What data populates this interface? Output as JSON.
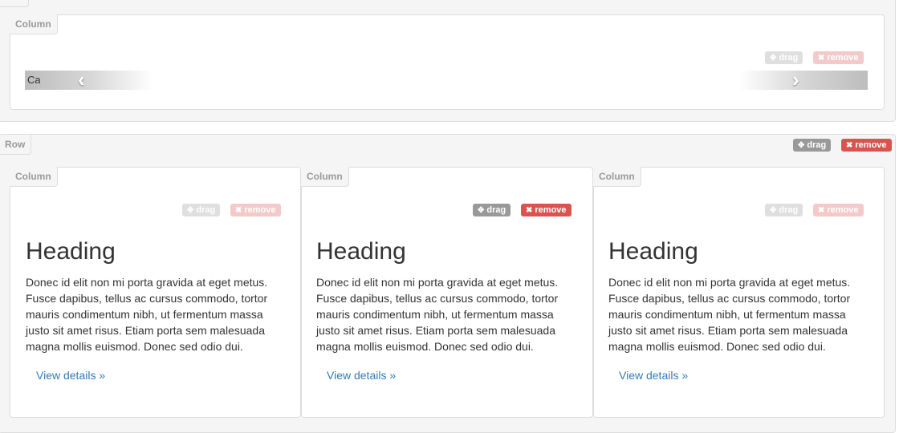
{
  "top_area": {
    "column_tag": "Column",
    "drag_label": "drag",
    "remove_label": "remove",
    "carousel": {
      "caption": "Ca",
      "prev_icon": "chevron-left-icon",
      "next_icon": "chevron-right-icon"
    }
  },
  "row": {
    "tag": "Row",
    "drag_label": "drag",
    "remove_label": "remove",
    "columns": [
      {
        "tag": "Column",
        "drag_label": "drag",
        "remove_label": "remove",
        "heading": "Heading",
        "text": "Donec id elit non mi porta gravida at eget metus. Fusce dapibus, tellus ac cursus commodo, tortor mauris condimentum nibh, ut fermentum massa justo sit amet risus. Etiam porta sem malesuada magna mollis euismod. Donec sed odio dui.",
        "link": "View details »"
      },
      {
        "tag": "Column",
        "drag_label": "drag",
        "remove_label": "remove",
        "heading": "Heading",
        "text": "Donec id elit non mi porta gravida at eget metus. Fusce dapibus, tellus ac cursus commodo, tortor mauris condimentum nibh, ut fermentum massa justo sit amet risus. Etiam porta sem malesuada magna mollis euismod. Donec sed odio dui.",
        "link": "View details »"
      },
      {
        "tag": "Column",
        "drag_label": "drag",
        "remove_label": "remove",
        "heading": "Heading",
        "text": "Donec id elit non mi porta gravida at eget metus. Fusce dapibus, tellus ac cursus commodo, tortor mauris condimentum nibh, ut fermentum massa justo sit amet risus. Etiam porta sem malesuada magna mollis euismod. Donec sed odio dui.",
        "link": "View details »"
      }
    ]
  },
  "icons": {
    "drag": "move-icon",
    "remove": "close-icon"
  },
  "colors": {
    "drag_button": "#999999",
    "remove_button": "#d9534f",
    "link": "#337ab7",
    "container_bg": "#f5f5f5",
    "border": "#dddddd"
  }
}
